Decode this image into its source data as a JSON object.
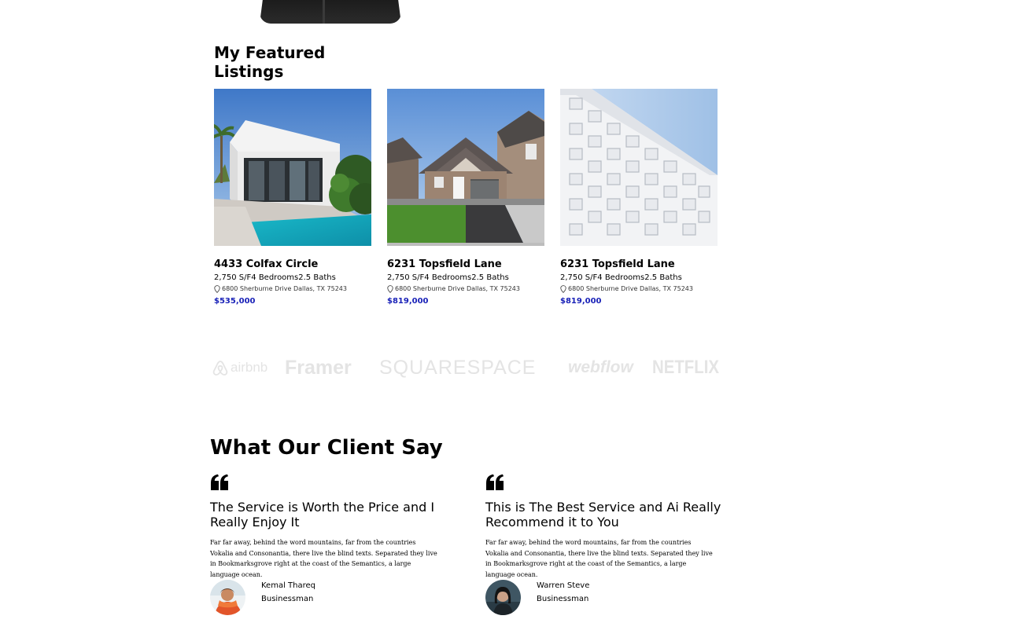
{
  "section_title": "My Featured Listings",
  "listings": [
    {
      "title": "4433 Colfax Circle",
      "specs": "2,750 S/F4 Bedrooms2.5 Baths",
      "address": "6800 Sherburne Drive Dallas, TX 75243",
      "price": "$535,000",
      "icon": "location-pin-icon"
    },
    {
      "title": "6231 Topsfield Lane",
      "specs": "2,750 S/F4 Bedrooms2.5 Baths",
      "address": "6800 Sherburne Drive Dallas, TX 75243",
      "price": "$819,000",
      "icon": "location-pin-icon"
    },
    {
      "title": "6231 Topsfield Lane",
      "specs": "2,750 S/F4 Bedrooms2.5 Baths",
      "address": "6800 Sherburne Drive Dallas, TX 75243",
      "price": "$819,000",
      "icon": "location-pin-icon"
    }
  ],
  "logos": {
    "airbnb": "airbnb",
    "framer": "Framer",
    "squarespace": "SQUARESPACE",
    "webflow": "webflow",
    "netflix": "NETFLIX"
  },
  "testimonials_title": "What Our Client Say",
  "testimonials": [
    {
      "heading": "The Service is Worth the Price and I Really Enjoy It",
      "body": "Far far away, behind the word mountains, far from the countries Vokalia and Consonantia, there live the blind texts. Separated they live in Bookmarksgrove right at the coast of the Semantics, a large language ocean.",
      "name": "Kemal Thareq",
      "role": "Businessman",
      "icon": "quote-icon"
    },
    {
      "heading": "This is The Best Service and Ai Really Recommend it to You",
      "body": "Far far away, behind the word mountains, far from the countries Vokalia and Consonantia, there live the blind texts. Separated they live in Bookmarksgrove right at the coast of the Semantics, a large language ocean.",
      "name": "Warren Steve",
      "role": "Businessman",
      "icon": "quote-icon"
    }
  ],
  "colors": {
    "price": "#1a22b8",
    "logo_gray": "#e4e4e4",
    "text": "#000000"
  }
}
